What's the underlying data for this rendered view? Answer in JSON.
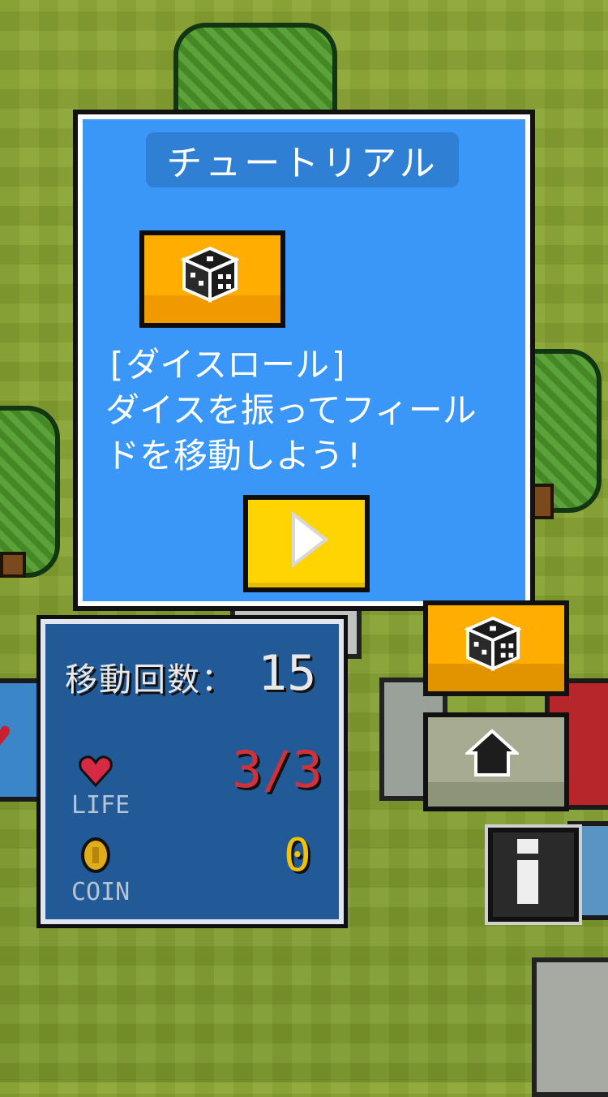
{
  "dialog": {
    "title": "チュートリアル",
    "heading": "[ダイスロール]",
    "body_line1": "ダイスを振ってフィール",
    "body_line2": "ドを移動しよう!",
    "dice_icon": "dice-icon",
    "next_icon": "play-triangle-icon"
  },
  "stats": {
    "moves_label": "移動回数：",
    "moves_value": "15",
    "life_label": "LIFE",
    "life_value": "3/3",
    "coin_label": "COIN",
    "coin_value": "0"
  },
  "buttons": {
    "dice": "dice-icon",
    "home": "home-icon",
    "info": "info-icon"
  },
  "colors": {
    "dialog_bg": "#3a97f8",
    "stats_bg": "#215a96",
    "accent_orange": "#ffad00",
    "accent_yellow": "#ffd400",
    "life_red": "#d1313a",
    "coin_gold": "#f2c300"
  }
}
